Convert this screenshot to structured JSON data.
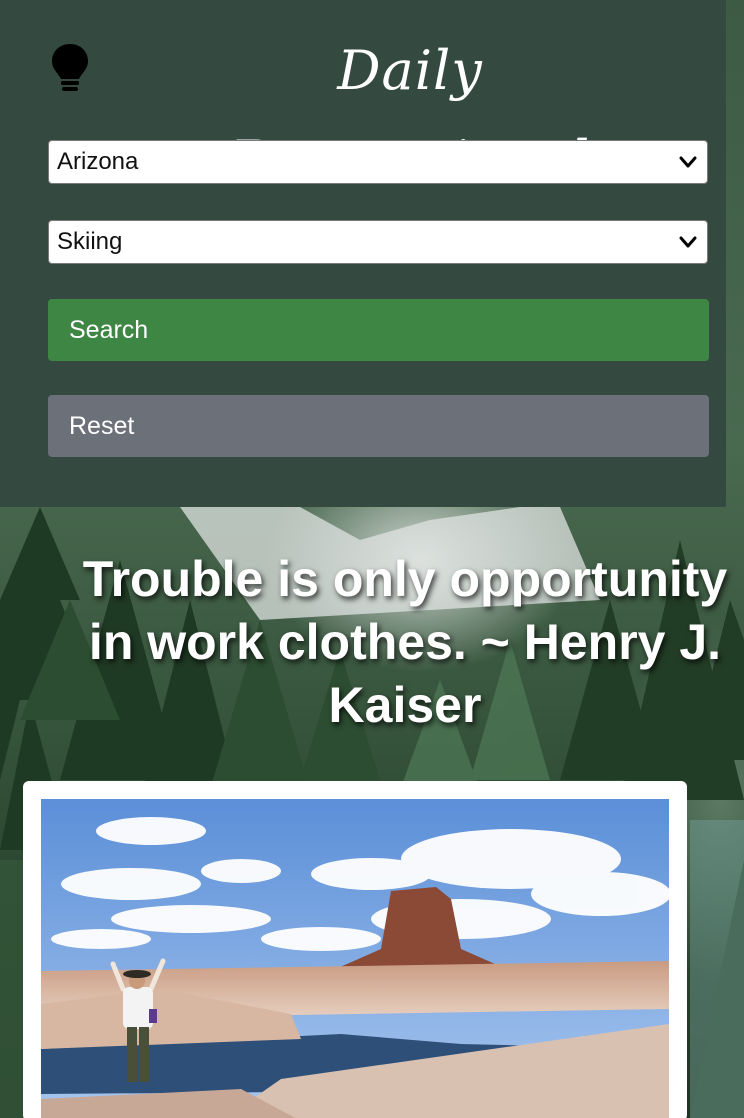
{
  "app": {
    "title": "Daily Recreational"
  },
  "filters": {
    "state_selected": "Arizona",
    "activity_selected": "Skiing"
  },
  "actions": {
    "search_label": "Search",
    "reset_label": "Reset"
  },
  "quote": {
    "text": "Trouble is only opportunity in work clothes. ~ Henry J. Kaiser"
  },
  "icons": {
    "header": "lightbulb-icon",
    "select_arrow": "chevron-down-icon"
  },
  "colors": {
    "header_bg": "#344a40",
    "search_button": "#3e8643",
    "reset_button": "#6b7079",
    "text_light": "#ffffff"
  }
}
